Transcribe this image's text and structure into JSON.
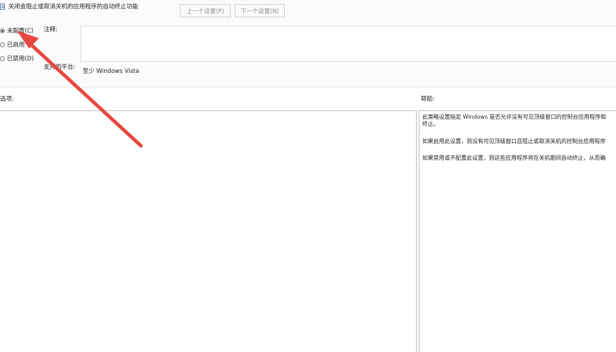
{
  "header": {
    "policy_title": "关闭会阻止或取消关机的应用程序的自动终止功能",
    "prev_button": "上一个设置(P)",
    "next_button": "下一个设置(N)"
  },
  "state_options": [
    {
      "label": "未配置(C)",
      "selected": true
    },
    {
      "label": "已启用",
      "selected": false
    },
    {
      "label": "已禁用(D)",
      "selected": false
    }
  ],
  "comment": {
    "label": "注释:",
    "value": ""
  },
  "supported": {
    "label": "支持的平台:",
    "value": "至少 Windows Vista"
  },
  "options": {
    "label": "选项:"
  },
  "help": {
    "label": "帮助:",
    "lines": [
      "此策略设置指定 Windows 是否允许没有可见顶级窗口的控制台应用程序和",
      "终止。",
      "如果启用此设置，则没有可见顶级窗口且阻止或取消关机的控制台应用程序",
      "如果禁用或不配置此设置，则这些应用程序将在关机期间自动终止，从而确"
    ]
  },
  "annotation": {
    "arrow_color": "#e8473f"
  }
}
